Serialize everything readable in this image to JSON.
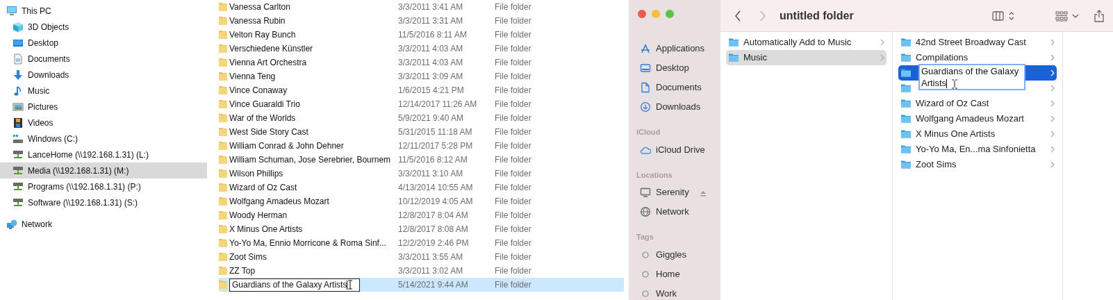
{
  "explorer": {
    "nav": [
      {
        "label": "This PC",
        "kind": "pc",
        "selected": false,
        "children": [
          {
            "label": "3D Objects",
            "kind": "cube",
            "selected": false
          },
          {
            "label": "Desktop",
            "kind": "desktop",
            "selected": false
          },
          {
            "label": "Documents",
            "kind": "documents",
            "selected": false
          },
          {
            "label": "Downloads",
            "kind": "downloads",
            "selected": false
          },
          {
            "label": "Music",
            "kind": "music",
            "selected": false
          },
          {
            "label": "Pictures",
            "kind": "pictures",
            "selected": false
          },
          {
            "label": "Videos",
            "kind": "videos",
            "selected": false
          },
          {
            "label": "Windows (C:)",
            "kind": "drive",
            "selected": false
          },
          {
            "label": "LanceHome (\\\\192.168.1.31) (L:)",
            "kind": "netdrive",
            "selected": false
          },
          {
            "label": "Media (\\\\192.168.1.31) (M:)",
            "kind": "netdrive",
            "selected": true
          },
          {
            "label": "Programs (\\\\192.168.1.31) (P:)",
            "kind": "netdrive",
            "selected": false
          },
          {
            "label": "Software (\\\\192.168.1.31) (S:)",
            "kind": "netdrive",
            "selected": false
          }
        ]
      },
      {
        "label": "Network",
        "kind": "network",
        "selected": false
      }
    ],
    "files": [
      {
        "name": "Vanessa Carlton",
        "date": "3/3/2011 3:41 AM",
        "type": "File folder",
        "selected": false,
        "editing": false
      },
      {
        "name": "Vanessa Rubin",
        "date": "3/3/2011 3:31 AM",
        "type": "File folder",
        "selected": false,
        "editing": false
      },
      {
        "name": "Velton Ray Bunch",
        "date": "11/5/2016 8:11 AM",
        "type": "File folder",
        "selected": false,
        "editing": false
      },
      {
        "name": "Verschiedene Künstler",
        "date": "3/3/2011 4:03 AM",
        "type": "File folder",
        "selected": false,
        "editing": false
      },
      {
        "name": "Vienna Art Orchestra",
        "date": "3/3/2011 4:03 AM",
        "type": "File folder",
        "selected": false,
        "editing": false
      },
      {
        "name": "Vienna Teng",
        "date": "3/3/2011 3:09 AM",
        "type": "File folder",
        "selected": false,
        "editing": false
      },
      {
        "name": "Vince Conaway",
        "date": "1/6/2015 4:21 PM",
        "type": "File folder",
        "selected": false,
        "editing": false
      },
      {
        "name": "Vince Guaraldi Trio",
        "date": "12/14/2017 11:26 AM",
        "type": "File folder",
        "selected": false,
        "editing": false
      },
      {
        "name": "War of the Worlds",
        "date": "5/9/2021 9:40 AM",
        "type": "File folder",
        "selected": false,
        "editing": false
      },
      {
        "name": "West Side Story Cast",
        "date": "5/31/2015 11:18 AM",
        "type": "File folder",
        "selected": false,
        "editing": false
      },
      {
        "name": "William Conrad & John Dehner",
        "date": "12/11/2017 5:28 PM",
        "type": "File folder",
        "selected": false,
        "editing": false
      },
      {
        "name": "William Schuman, Jose Serebrier, Bournem",
        "date": "11/5/2016 8:12 AM",
        "type": "File folder",
        "selected": false,
        "editing": false
      },
      {
        "name": "Wilson Phillips",
        "date": "3/3/2011 3:10 AM",
        "type": "File folder",
        "selected": false,
        "editing": false
      },
      {
        "name": "Wizard of Oz Cast",
        "date": "4/13/2014 10:55 AM",
        "type": "File folder",
        "selected": false,
        "editing": false
      },
      {
        "name": "Wolfgang Amadeus Mozart",
        "date": "10/12/2019 4:05 AM",
        "type": "File folder",
        "selected": false,
        "editing": false
      },
      {
        "name": "Woody Herman",
        "date": "12/8/2017 8:04 AM",
        "type": "File folder",
        "selected": false,
        "editing": false
      },
      {
        "name": "X Minus One Artists",
        "date": "12/8/2017 8:08 AM",
        "type": "File folder",
        "selected": false,
        "editing": false
      },
      {
        "name": "Yo-Yo Ma, Ennio Morricone & Roma Sinf...",
        "date": "12/2/2019 2:46 PM",
        "type": "File folder",
        "selected": false,
        "editing": false
      },
      {
        "name": "Zoot Sims",
        "date": "3/3/2011 3:55 AM",
        "type": "File folder",
        "selected": false,
        "editing": false
      },
      {
        "name": "ZZ Top",
        "date": "3/3/2011 3:02 AM",
        "type": "File folder",
        "selected": false,
        "editing": false
      },
      {
        "name": "Guardians of the Galaxy Artists",
        "date": "5/14/2021 9:44 AM",
        "type": "File folder",
        "selected": true,
        "editing": true
      }
    ]
  },
  "finder": {
    "title": "untitled folder",
    "sidebar": [
      {
        "items": [
          {
            "label": "Applications",
            "kind": "apps"
          },
          {
            "label": "Desktop",
            "kind": "desktop"
          },
          {
            "label": "Documents",
            "kind": "doc"
          },
          {
            "label": "Downloads",
            "kind": "download"
          }
        ]
      },
      {
        "heading": "iCloud",
        "items": [
          {
            "label": "iCloud Drive",
            "kind": "cloud"
          }
        ]
      },
      {
        "heading": "Locations",
        "items": [
          {
            "label": "Serenity",
            "kind": "computer",
            "eject": true
          },
          {
            "label": "Network",
            "kind": "globe"
          }
        ]
      },
      {
        "heading": "Tags",
        "items": [
          {
            "label": "Giggles",
            "kind": "tag"
          },
          {
            "label": "Home",
            "kind": "tag"
          },
          {
            "label": "Work",
            "kind": "tag"
          }
        ]
      }
    ],
    "columns": [
      {
        "focused": false,
        "items": [
          {
            "kind": "folder",
            "name": "Automatically Add to Music",
            "selected": false,
            "editing": false
          },
          {
            "kind": "folder",
            "name": "Music",
            "selected": true,
            "editing": false
          }
        ]
      },
      {
        "focused": true,
        "items": [
          {
            "kind": "folder",
            "name": "42nd Street Broadway Cast",
            "selected": false,
            "editing": false
          },
          {
            "kind": "folder",
            "name": "Compilations",
            "selected": false,
            "editing": false
          },
          {
            "kind": "folder",
            "name": "Guardians of the Galaxy Artists",
            "selected": true,
            "editing": true
          },
          {
            "kind": "covered",
            "selected": false,
            "editing": false
          },
          {
            "kind": "folder",
            "name": "Wizard of Oz Cast",
            "selected": false,
            "editing": false
          },
          {
            "kind": "folder",
            "name": "Wolfgang Amadeus Mozart",
            "selected": false,
            "editing": false
          },
          {
            "kind": "folder",
            "name": "X Minus One Artists",
            "selected": false,
            "editing": false
          },
          {
            "kind": "folder",
            "name": "Yo-Yo Ma, En...ma Sinfonietta",
            "selected": false,
            "editing": false
          },
          {
            "kind": "folder",
            "name": "Zoot Sims",
            "selected": false,
            "editing": false
          }
        ]
      }
    ]
  }
}
